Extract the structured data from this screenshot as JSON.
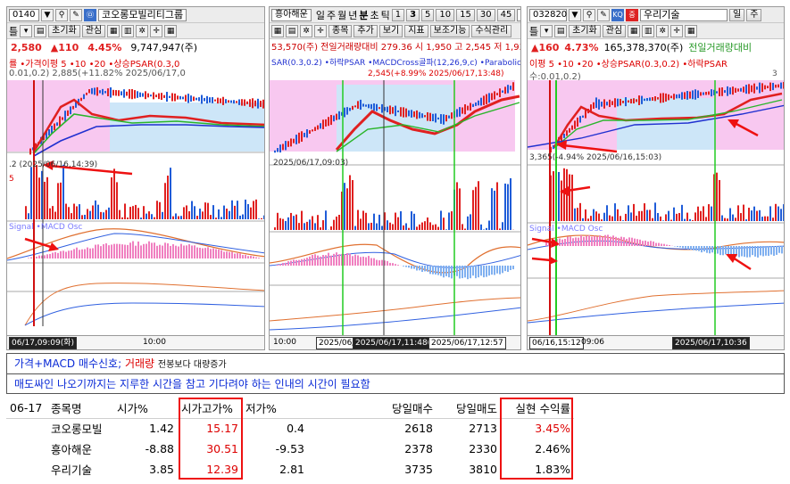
{
  "colors": {
    "up": "#e02020",
    "down": "#1f5cd8",
    "ma5": "#e02020",
    "ma10": "#2ab52a",
    "ma20": "#2030d0",
    "signal_line": "#22cc22",
    "highlight": "#ee1111",
    "note_text": "#0a2ad6"
  },
  "panels": [
    {
      "code": "0140",
      "name": "코오롱모빌리티그룹",
      "search_icon": "search-icon",
      "tool_icon": "wrench-icon",
      "toolbar_items": [
        "틀",
        "초기화",
        "관심"
      ],
      "price": "2,580",
      "change": "▲110",
      "pct": "4.45%",
      "volume": "9,747,947(주)",
      "legend": "률 •가격이평 5 •10 •20 •상승PSAR(0.3,0",
      "ann1": "0.01,0.2) 2,885(+11.82% 2025/06/17,0",
      "ann2": ".2 (2025/06/16,14:39)",
      "vol_label": "5",
      "macd_label": "Signal •MACD Osc",
      "time1": "06/17,09:09(화)",
      "time2": "10:00"
    },
    {
      "name": "흥아해운",
      "tabs": [
        "일",
        "주",
        "월",
        "년",
        "분",
        "초",
        "틱"
      ],
      "periods": [
        "1",
        "3",
        "5",
        "10",
        "15",
        "30",
        "45"
      ],
      "period_sel": "3",
      "tools": [
        "종목",
        "추가",
        "보기",
        "지표"
      ],
      "btn1": "보조기능",
      "btn2": "수식관리",
      "info": "53,570(주)  전일거래량대비 279.36  시 1,950  고 2,545  저 1,936",
      "legend": "SAR(0.3,0.2) •하락PSAR •MACDCross골파(12,26,9,c) •Parabolic신호(매도)(0.01,0.",
      "ann1": "2,545(+8.99% 2025/06/17,13:48)",
      "ann2": "2025/06/17,09:03)",
      "time1": "10:00",
      "time2": "2025/06/17",
      "time3": "2025/06/17,11:48(화)",
      "time4": "2025/06/17,12:57"
    },
    {
      "code": "032820",
      "name": "우리기술",
      "tabs": [
        "일",
        "주"
      ],
      "toolbar_items": [
        "틀",
        "초기화",
        "관심"
      ],
      "price": "▲160",
      "pct": "4.73%",
      "volume": "165,378,370(주)",
      "info": "전일거래량대비",
      "legend": "이평 5 •10 •20 •상승PSAR(0.3,0.2) •하락PSAR",
      "ann1": "수:0.01,0.2)",
      "ann2": "3,365(-4.94% 2025/06/16,15:03)",
      "ann_top": "3",
      "macd_label": "Signal •MACD Osc",
      "time1": "06/16,15:12",
      "time2": "09:06",
      "time3": "2025/06/17,10:36"
    }
  ],
  "notes": {
    "line1_a": "가격+MACD 매수신호;",
    "line1_b": "거래량",
    "line1_c": "전봉보다 대량증가",
    "line2": "매도싸인 나오기까지는 지루한 시간을 참고 기다려야 하는 인내의 시간이 필요함"
  },
  "table": {
    "headers": [
      "06-17",
      "종목명",
      "시가%",
      "시가고가%",
      "저가%",
      "",
      "당일매수",
      "당일매도",
      "실현 수익률"
    ],
    "rows": [
      [
        "",
        "코오롱모빌",
        "1.42",
        "15.17",
        "0.4",
        "",
        "2618",
        "2713",
        "3.45%"
      ],
      [
        "",
        "흥아해운",
        "-8.88",
        "30.51",
        "-9.53",
        "",
        "2378",
        "2330",
        "2.46%"
      ],
      [
        "",
        "우리기술",
        "3.85",
        "12.39",
        "2.81",
        "",
        "3735",
        "3810",
        "1.83%"
      ]
    ]
  }
}
